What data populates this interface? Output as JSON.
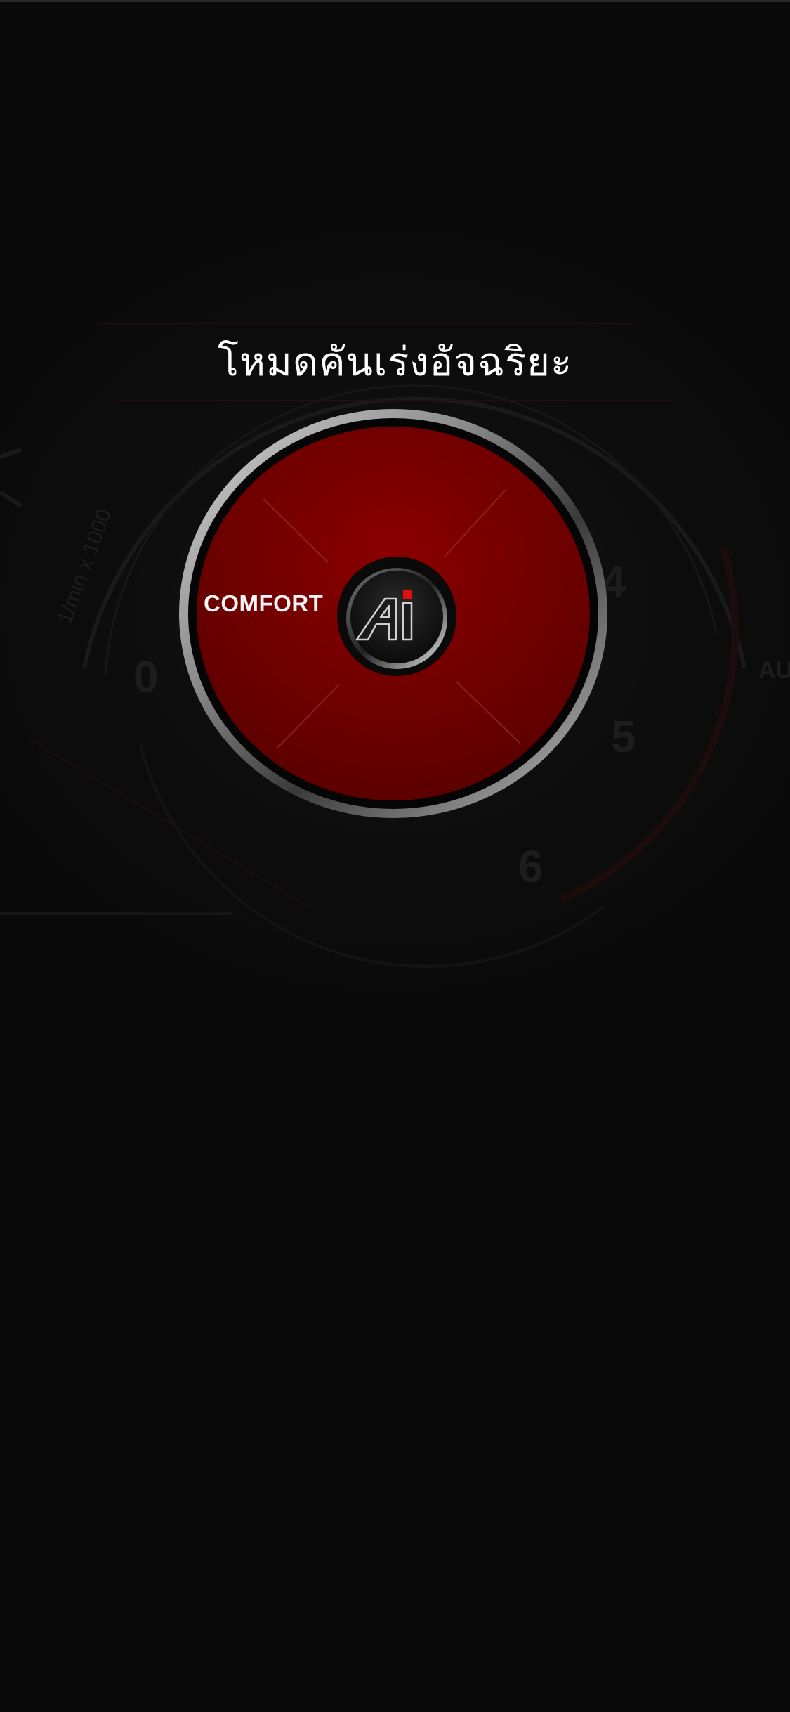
{
  "screen": {
    "title": "โหมดคันเร่งอัจฉริยะ"
  },
  "dial": {
    "mode_label": "COMFORT",
    "center_button_icon": "ai-logo-icon",
    "center_button_text": "AI",
    "fill_color": "#6b0000",
    "ring_color": "#b8b8b8",
    "accent_color": "#e01010"
  },
  "background_gauge": {
    "unit_label": "1/min x 1000",
    "tick_labels": [
      "0",
      "4",
      "5",
      "6"
    ],
    "side_label": "AU"
  }
}
